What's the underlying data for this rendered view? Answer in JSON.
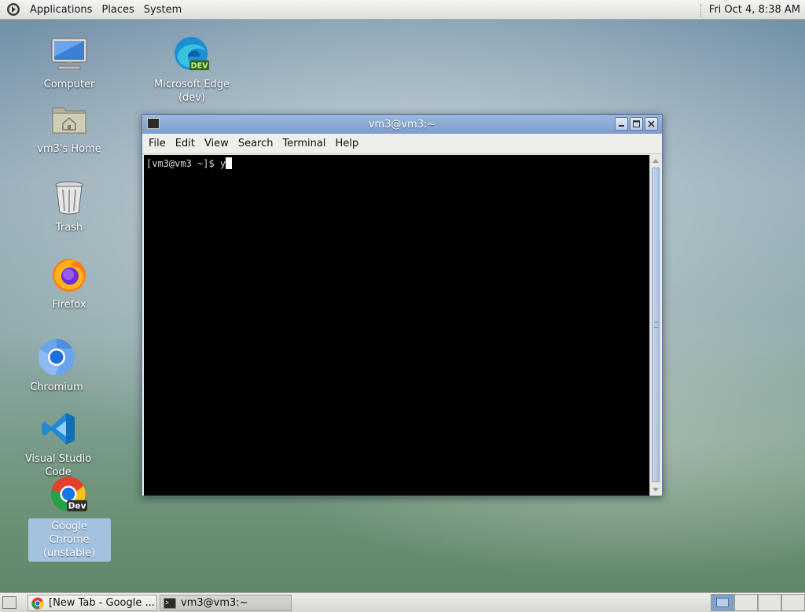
{
  "top_panel": {
    "menus": [
      "Applications",
      "Places",
      "System"
    ],
    "clock": "Fri Oct  4,  8:38 AM"
  },
  "desktop_icons": [
    {
      "label": "Computer",
      "icon": "computer-icon"
    },
    {
      "label": "Microsoft Edge (dev)",
      "icon": "edge-dev-icon"
    },
    {
      "label": "vm3's Home",
      "icon": "home-folder-icon"
    },
    {
      "label": "Trash",
      "icon": "trash-icon"
    },
    {
      "label": "Firefox",
      "icon": "firefox-icon"
    },
    {
      "label": "Chromium",
      "icon": "chromium-icon"
    },
    {
      "label": "Visual Studio Code",
      "icon": "vscode-icon"
    },
    {
      "label": "Google Chrome (unstable)",
      "icon": "chrome-dev-icon",
      "selected": true
    }
  ],
  "terminal": {
    "title": "vm3@vm3:~",
    "menus": [
      "File",
      "Edit",
      "View",
      "Search",
      "Terminal",
      "Help"
    ],
    "prompt": "[vm3@vm3 ~]$ y"
  },
  "taskbar": {
    "tasks": [
      {
        "label": "[New Tab - Google ...",
        "icon": "chrome-icon"
      },
      {
        "label": "vm3@vm3:~",
        "icon": "terminal-icon",
        "active": true
      }
    ]
  },
  "colors": {
    "titlebar": "#7c9ccd",
    "terminal_bg": "#000000",
    "selection": "#a3c2e0"
  }
}
